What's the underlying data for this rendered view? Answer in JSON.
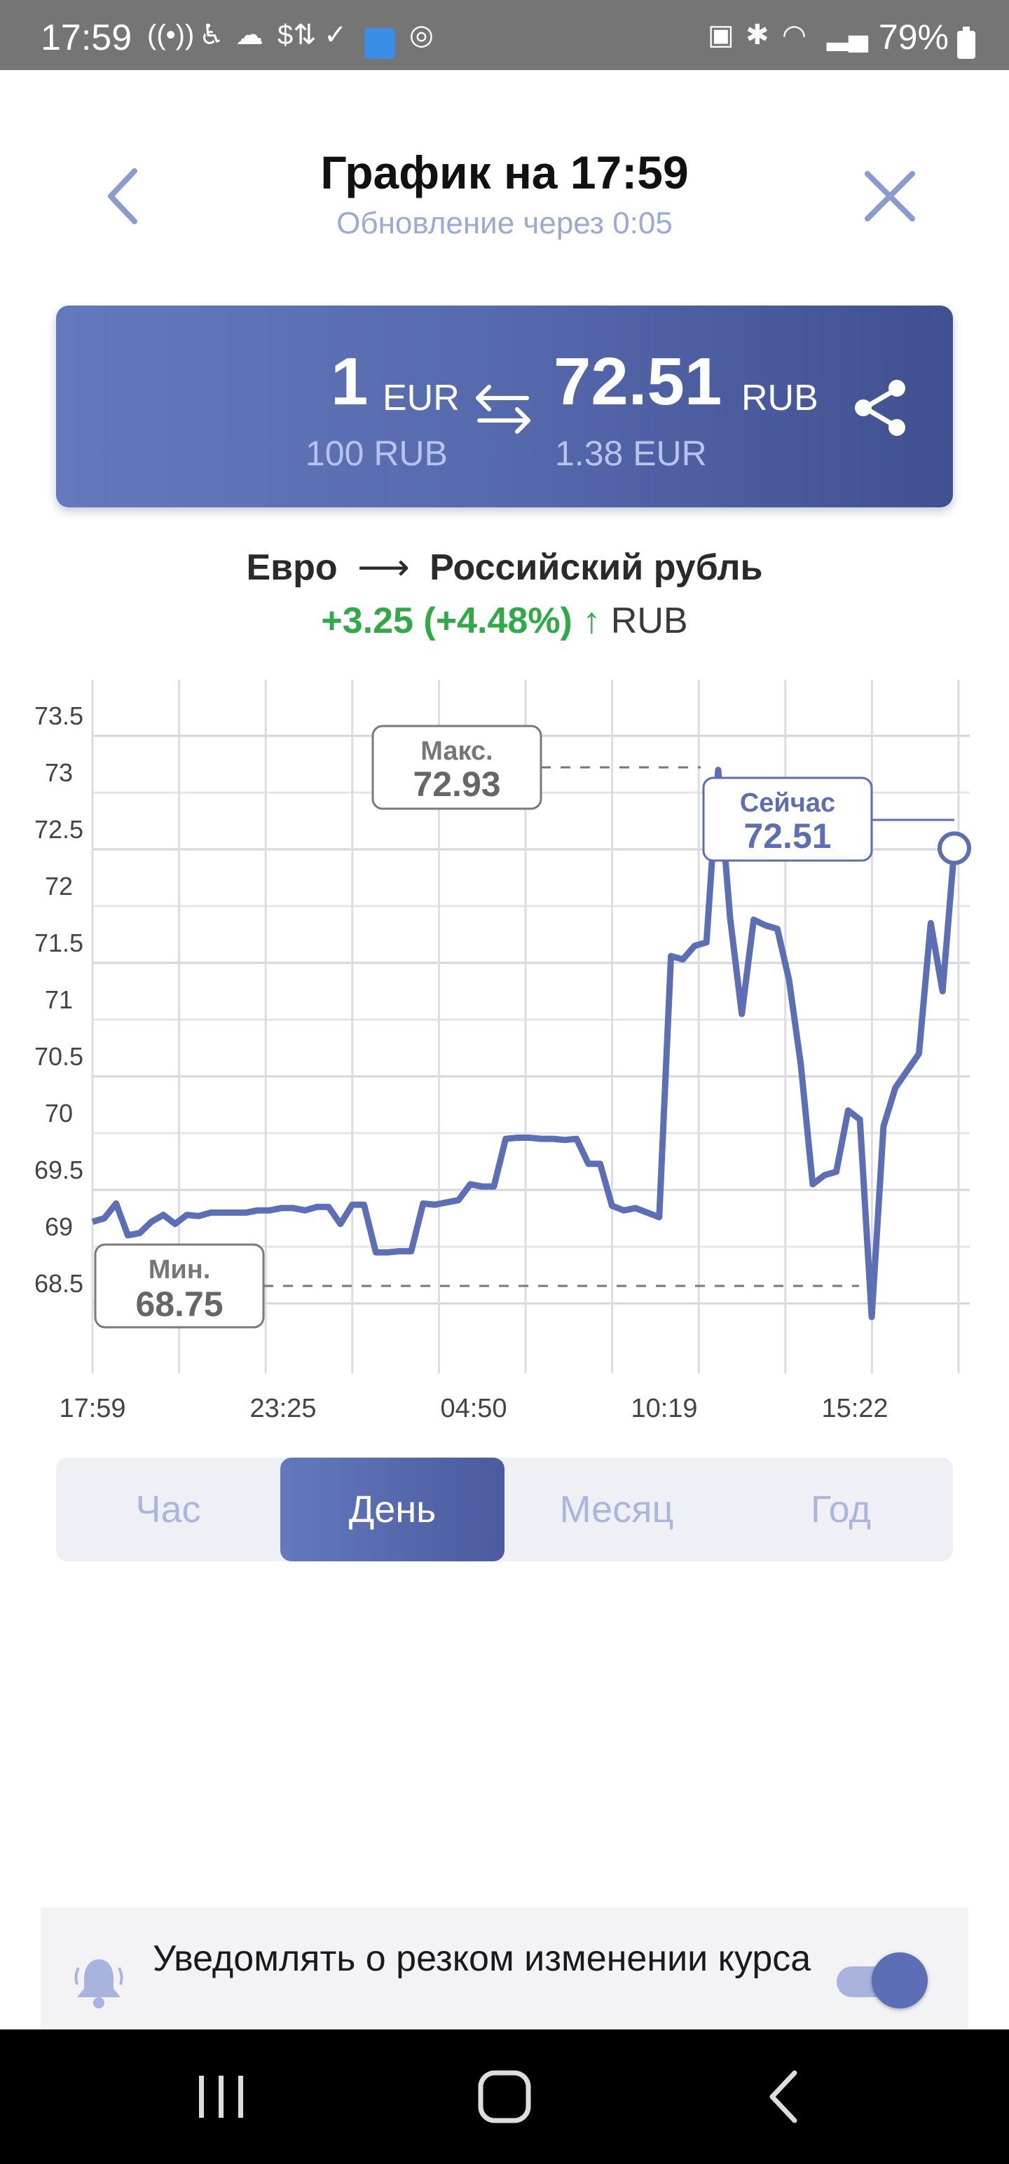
{
  "status_bar": {
    "time": "17:59",
    "icons": [
      "hotspot-icon",
      "accessibility-icon",
      "cloud-icon",
      "currency-icon",
      "check-icon",
      "app-icon",
      "shazam-icon"
    ],
    "right_icons": [
      "battery-saver-icon",
      "bluetooth-icon",
      "wifi-icon",
      "signal-icon"
    ],
    "battery": "79%"
  },
  "header": {
    "title": "График на 17:59",
    "subtitle": "Обновление через 0:05"
  },
  "converter": {
    "from_amount": "1",
    "from_currency": "EUR",
    "from_sub": "100 RUB",
    "to_amount": "72.51",
    "to_currency": "RUB",
    "to_sub": "1.38 EUR"
  },
  "pair": {
    "from": "Евро",
    "arrow": "⟶",
    "to": "Российский рубль",
    "change": "+3.25 (+4.48%) ↑",
    "change_currency": "RUB"
  },
  "chart_data": {
    "type": "line",
    "y_ticks": [
      "73.5",
      "73",
      "72.5",
      "72",
      "71.5",
      "71",
      "70.5",
      "70",
      "69.5",
      "69",
      "68.5"
    ],
    "x_ticks": [
      "17:59",
      "23:25",
      "04:50",
      "10:19",
      "15:22"
    ],
    "ylim": [
      68.0,
      73.8
    ],
    "max_label": "Макс.",
    "max_value": "72.93",
    "min_label": "Мин.",
    "min_value": "68.75",
    "now_label": "Сейчас",
    "now_value": "72.51",
    "color": "#5b6eb6",
    "values": [
      69.22,
      69.25,
      69.38,
      69.1,
      69.12,
      69.22,
      69.28,
      69.2,
      69.28,
      69.27,
      69.3,
      69.3,
      69.3,
      69.3,
      69.32,
      69.32,
      69.34,
      69.34,
      69.32,
      69.35,
      69.35,
      69.2,
      69.37,
      69.37,
      68.95,
      68.95,
      68.96,
      68.96,
      69.38,
      69.37,
      69.39,
      69.41,
      69.55,
      69.53,
      69.53,
      69.95,
      69.96,
      69.96,
      69.95,
      69.95,
      69.94,
      69.95,
      69.73,
      69.73,
      69.36,
      69.32,
      69.34,
      69.3,
      69.26,
      71.56,
      71.53,
      71.65,
      71.68,
      73.2,
      71.9,
      71.05,
      71.88,
      71.83,
      71.8,
      71.35,
      70.6,
      69.55,
      69.63,
      69.66,
      70.2,
      70.12,
      68.38,
      70.06,
      70.4,
      70.55,
      70.7,
      71.85,
      71.25,
      72.51
    ]
  },
  "range_tabs": [
    {
      "label": "Час"
    },
    {
      "label": "День"
    },
    {
      "label": "Месяц"
    },
    {
      "label": "Год"
    }
  ],
  "notify": {
    "text": "Уведомлять о резком изменении курса"
  }
}
